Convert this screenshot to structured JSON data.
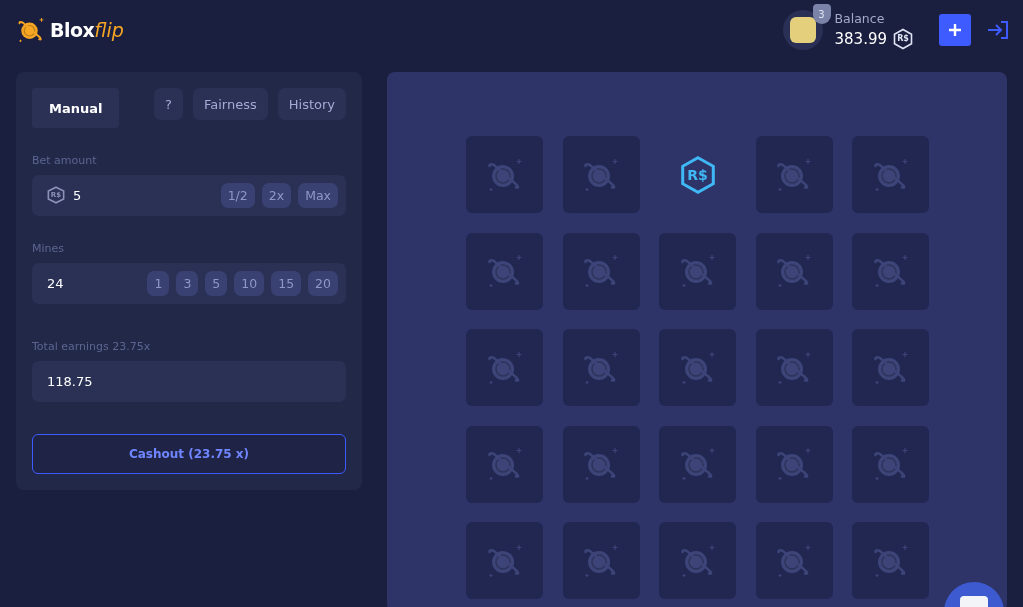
{
  "header": {
    "logo": {
      "word": "Blox",
      "accent": "flip"
    },
    "avatar": {
      "rank": "3"
    },
    "balance": {
      "label": "Balance",
      "amount": "383.99",
      "currency": "R$"
    }
  },
  "controls": {
    "tabs": [
      {
        "label": "Manual",
        "selected": true
      }
    ],
    "help": "?",
    "links": [
      "Fairness",
      "History"
    ],
    "bet": {
      "label": "Bet amount",
      "currency": "R$",
      "value": "5",
      "buttons": [
        "1/2",
        "2x",
        "Max"
      ]
    },
    "mines": {
      "label": "Mines",
      "value": "24",
      "buttons": [
        "1",
        "3",
        "5",
        "10",
        "15",
        "20"
      ]
    },
    "earnings": {
      "label": "Total earnings 23.75x",
      "value": "118.75"
    },
    "cashout": "Cashout (23.75 x)"
  },
  "board": {
    "tiles": [
      {
        "kind": "hidden"
      },
      {
        "kind": "hidden"
      },
      {
        "kind": "gem",
        "symbol": "R$"
      },
      {
        "kind": "hidden"
      },
      {
        "kind": "hidden"
      },
      {
        "kind": "hidden"
      },
      {
        "kind": "hidden"
      },
      {
        "kind": "hidden"
      },
      {
        "kind": "hidden"
      },
      {
        "kind": "hidden"
      },
      {
        "kind": "hidden"
      },
      {
        "kind": "hidden"
      },
      {
        "kind": "hidden"
      },
      {
        "kind": "hidden"
      },
      {
        "kind": "hidden"
      },
      {
        "kind": "hidden"
      },
      {
        "kind": "hidden"
      },
      {
        "kind": "hidden"
      },
      {
        "kind": "hidden"
      },
      {
        "kind": "hidden"
      },
      {
        "kind": "hidden"
      },
      {
        "kind": "hidden"
      },
      {
        "kind": "hidden"
      },
      {
        "kind": "hidden"
      },
      {
        "kind": "hidden"
      }
    ]
  }
}
